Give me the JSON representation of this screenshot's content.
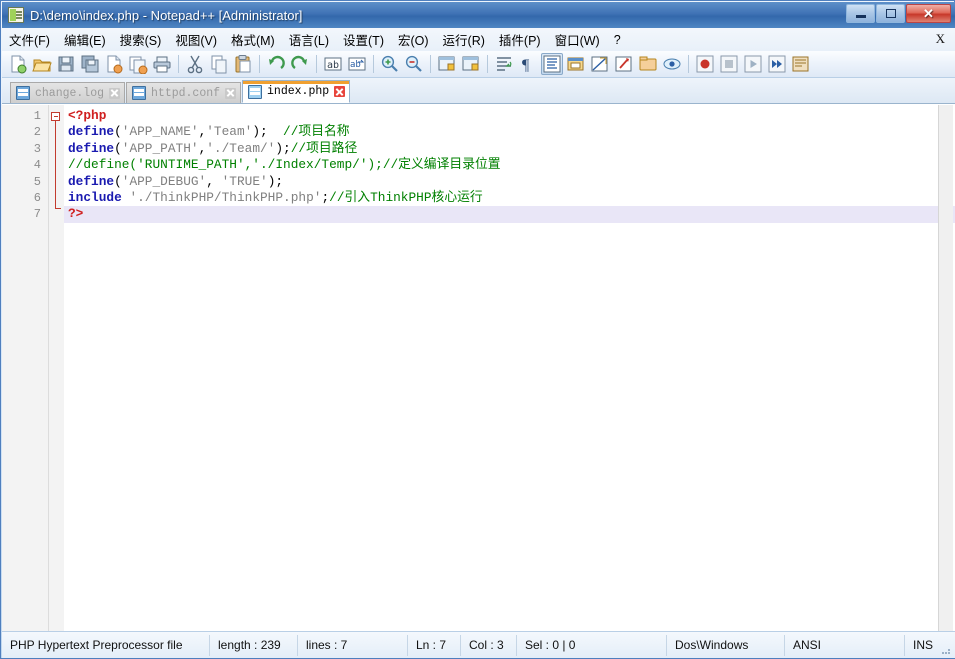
{
  "window": {
    "title": "D:\\demo\\index.php - Notepad++ [Administrator]",
    "icon": "notepad-plus-plus-icon",
    "buttons": {
      "minimize": "minimize-icon",
      "maximize": "maximize-icon",
      "close": "✕"
    }
  },
  "menubar": {
    "items": [
      {
        "label": "文件(F)",
        "name": "menu-file"
      },
      {
        "label": "编辑(E)",
        "name": "menu-edit"
      },
      {
        "label": "搜索(S)",
        "name": "menu-search"
      },
      {
        "label": "视图(V)",
        "name": "menu-view"
      },
      {
        "label": "格式(M)",
        "name": "menu-format"
      },
      {
        "label": "语言(L)",
        "name": "menu-language"
      },
      {
        "label": "设置(T)",
        "name": "menu-settings"
      },
      {
        "label": "宏(O)",
        "name": "menu-macro"
      },
      {
        "label": "运行(R)",
        "name": "menu-run"
      },
      {
        "label": "插件(P)",
        "name": "menu-plugins"
      },
      {
        "label": "窗口(W)",
        "name": "menu-window"
      },
      {
        "label": "?",
        "name": "menu-help"
      }
    ],
    "close_doc_label": "X"
  },
  "toolbar": {
    "buttons": [
      {
        "name": "new-file-icon",
        "tip": "New"
      },
      {
        "name": "open-file-icon",
        "tip": "Open"
      },
      {
        "name": "save-icon",
        "tip": "Save"
      },
      {
        "name": "save-all-icon",
        "tip": "Save All"
      },
      {
        "name": "close-file-icon",
        "tip": "Close"
      },
      {
        "name": "close-all-files-icon",
        "tip": "Close All"
      },
      {
        "name": "print-icon",
        "tip": "Print"
      },
      {
        "name": "separator-1",
        "tip": ""
      },
      {
        "name": "cut-icon",
        "tip": "Cut"
      },
      {
        "name": "copy-icon",
        "tip": "Copy"
      },
      {
        "name": "paste-icon",
        "tip": "Paste"
      },
      {
        "name": "separator-2",
        "tip": ""
      },
      {
        "name": "undo-icon",
        "tip": "Undo"
      },
      {
        "name": "redo-icon",
        "tip": "Redo"
      },
      {
        "name": "separator-3",
        "tip": ""
      },
      {
        "name": "find-icon",
        "tip": "Find"
      },
      {
        "name": "replace-icon",
        "tip": "Replace"
      },
      {
        "name": "separator-4",
        "tip": ""
      },
      {
        "name": "zoom-in-icon",
        "tip": "Zoom In"
      },
      {
        "name": "zoom-out-icon",
        "tip": "Zoom Out"
      },
      {
        "name": "separator-5",
        "tip": ""
      },
      {
        "name": "sync-vertical-scroll-icon",
        "tip": "Sync Vertical"
      },
      {
        "name": "sync-horizontal-scroll-icon",
        "tip": "Sync Horizontal"
      },
      {
        "name": "separator-6",
        "tip": ""
      },
      {
        "name": "word-wrap-icon",
        "tip": "Word Wrap"
      },
      {
        "name": "show-all-characters-icon",
        "tip": "Show All Characters"
      },
      {
        "name": "show-indent-guide-icon",
        "tip": "Indent Guide",
        "active": true
      },
      {
        "name": "ui-dialog-icon",
        "tip": "User Defined Dialogue"
      },
      {
        "name": "show-blank-icon",
        "tip": "Show Blank"
      },
      {
        "name": "document-map-icon",
        "tip": "Document Map"
      },
      {
        "name": "function-list-icon",
        "tip": "Function List"
      },
      {
        "name": "folder-as-workspace-icon",
        "tip": "Folder as Workspace"
      },
      {
        "name": "separator-7",
        "tip": ""
      },
      {
        "name": "record-macro-icon",
        "tip": "Start Recording"
      },
      {
        "name": "stop-macro-icon",
        "tip": "Stop Recording"
      },
      {
        "name": "play-macro-icon",
        "tip": "Playback"
      },
      {
        "name": "run-macro-multiple-icon",
        "tip": "Run Multiple Times"
      },
      {
        "name": "save-macro-icon",
        "tip": "Save Macro"
      }
    ]
  },
  "tabs": [
    {
      "label": "change.log",
      "active": false
    },
    {
      "label": "httpd.conf",
      "active": false
    },
    {
      "label": "index.php",
      "active": true
    }
  ],
  "editor": {
    "line_numbers": [
      "1",
      "2",
      "3",
      "4",
      "5",
      "6",
      "7"
    ],
    "current_line": 7,
    "lines": [
      {
        "n": 1,
        "tokens": [
          {
            "t": "<?php",
            "c": "tok-php"
          }
        ]
      },
      {
        "n": 2,
        "tokens": [
          {
            "t": "define",
            "c": "tok-kw"
          },
          {
            "t": "(",
            "c": "tok-punct"
          },
          {
            "t": "'APP_NAME'",
            "c": "tok-str"
          },
          {
            "t": ",",
            "c": "tok-punct"
          },
          {
            "t": "'Team'",
            "c": "tok-str"
          },
          {
            "t": ");  ",
            "c": "tok-punct"
          },
          {
            "t": "//项目名称",
            "c": "tok-cmt"
          }
        ]
      },
      {
        "n": 3,
        "tokens": [
          {
            "t": "define",
            "c": "tok-kw"
          },
          {
            "t": "(",
            "c": "tok-punct"
          },
          {
            "t": "'APP_PATH'",
            "c": "tok-str"
          },
          {
            "t": ",",
            "c": "tok-punct"
          },
          {
            "t": "'./Team/'",
            "c": "tok-str"
          },
          {
            "t": ");",
            "c": "tok-punct"
          },
          {
            "t": "//项目路径",
            "c": "tok-cmt"
          }
        ]
      },
      {
        "n": 4,
        "tokens": [
          {
            "t": "//define('RUNTIME_PATH','./Index/Temp/');//定义编译目录位置",
            "c": "tok-cmt"
          }
        ]
      },
      {
        "n": 5,
        "tokens": [
          {
            "t": "define",
            "c": "tok-kw"
          },
          {
            "t": "(",
            "c": "tok-punct"
          },
          {
            "t": "'APP_DEBUG'",
            "c": "tok-str"
          },
          {
            "t": ", ",
            "c": "tok-punct"
          },
          {
            "t": "'TRUE'",
            "c": "tok-str"
          },
          {
            "t": ");",
            "c": "tok-punct"
          }
        ]
      },
      {
        "n": 6,
        "tokens": [
          {
            "t": "include",
            "c": "tok-kw"
          },
          {
            "t": " ",
            "c": "tok-punct"
          },
          {
            "t": "'./ThinkPHP/ThinkPHP.php'",
            "c": "tok-str"
          },
          {
            "t": ";",
            "c": "tok-punct"
          },
          {
            "t": "//引入ThinkPHP核心运行",
            "c": "tok-cmt"
          }
        ]
      },
      {
        "n": 7,
        "tokens": [
          {
            "t": "?>",
            "c": "tok-php"
          }
        ]
      }
    ]
  },
  "statusbar": {
    "file_type": "PHP Hypertext Preprocessor file",
    "length": "length : 239",
    "lines": "lines : 7",
    "ln": "Ln : 7",
    "col": "Col : 3",
    "sel": "Sel : 0 | 0",
    "eol": "Dos\\Windows",
    "encoding": "ANSI",
    "insert_mode": "INS"
  },
  "colors": {
    "title_accent": "#3f72b5",
    "active_tab_accent": "#f0a030",
    "php_tag": "#d02020",
    "keyword": "#1a1ab0",
    "string": "#808080",
    "comment": "#008000",
    "current_line_bg": "#e9e6f7"
  }
}
